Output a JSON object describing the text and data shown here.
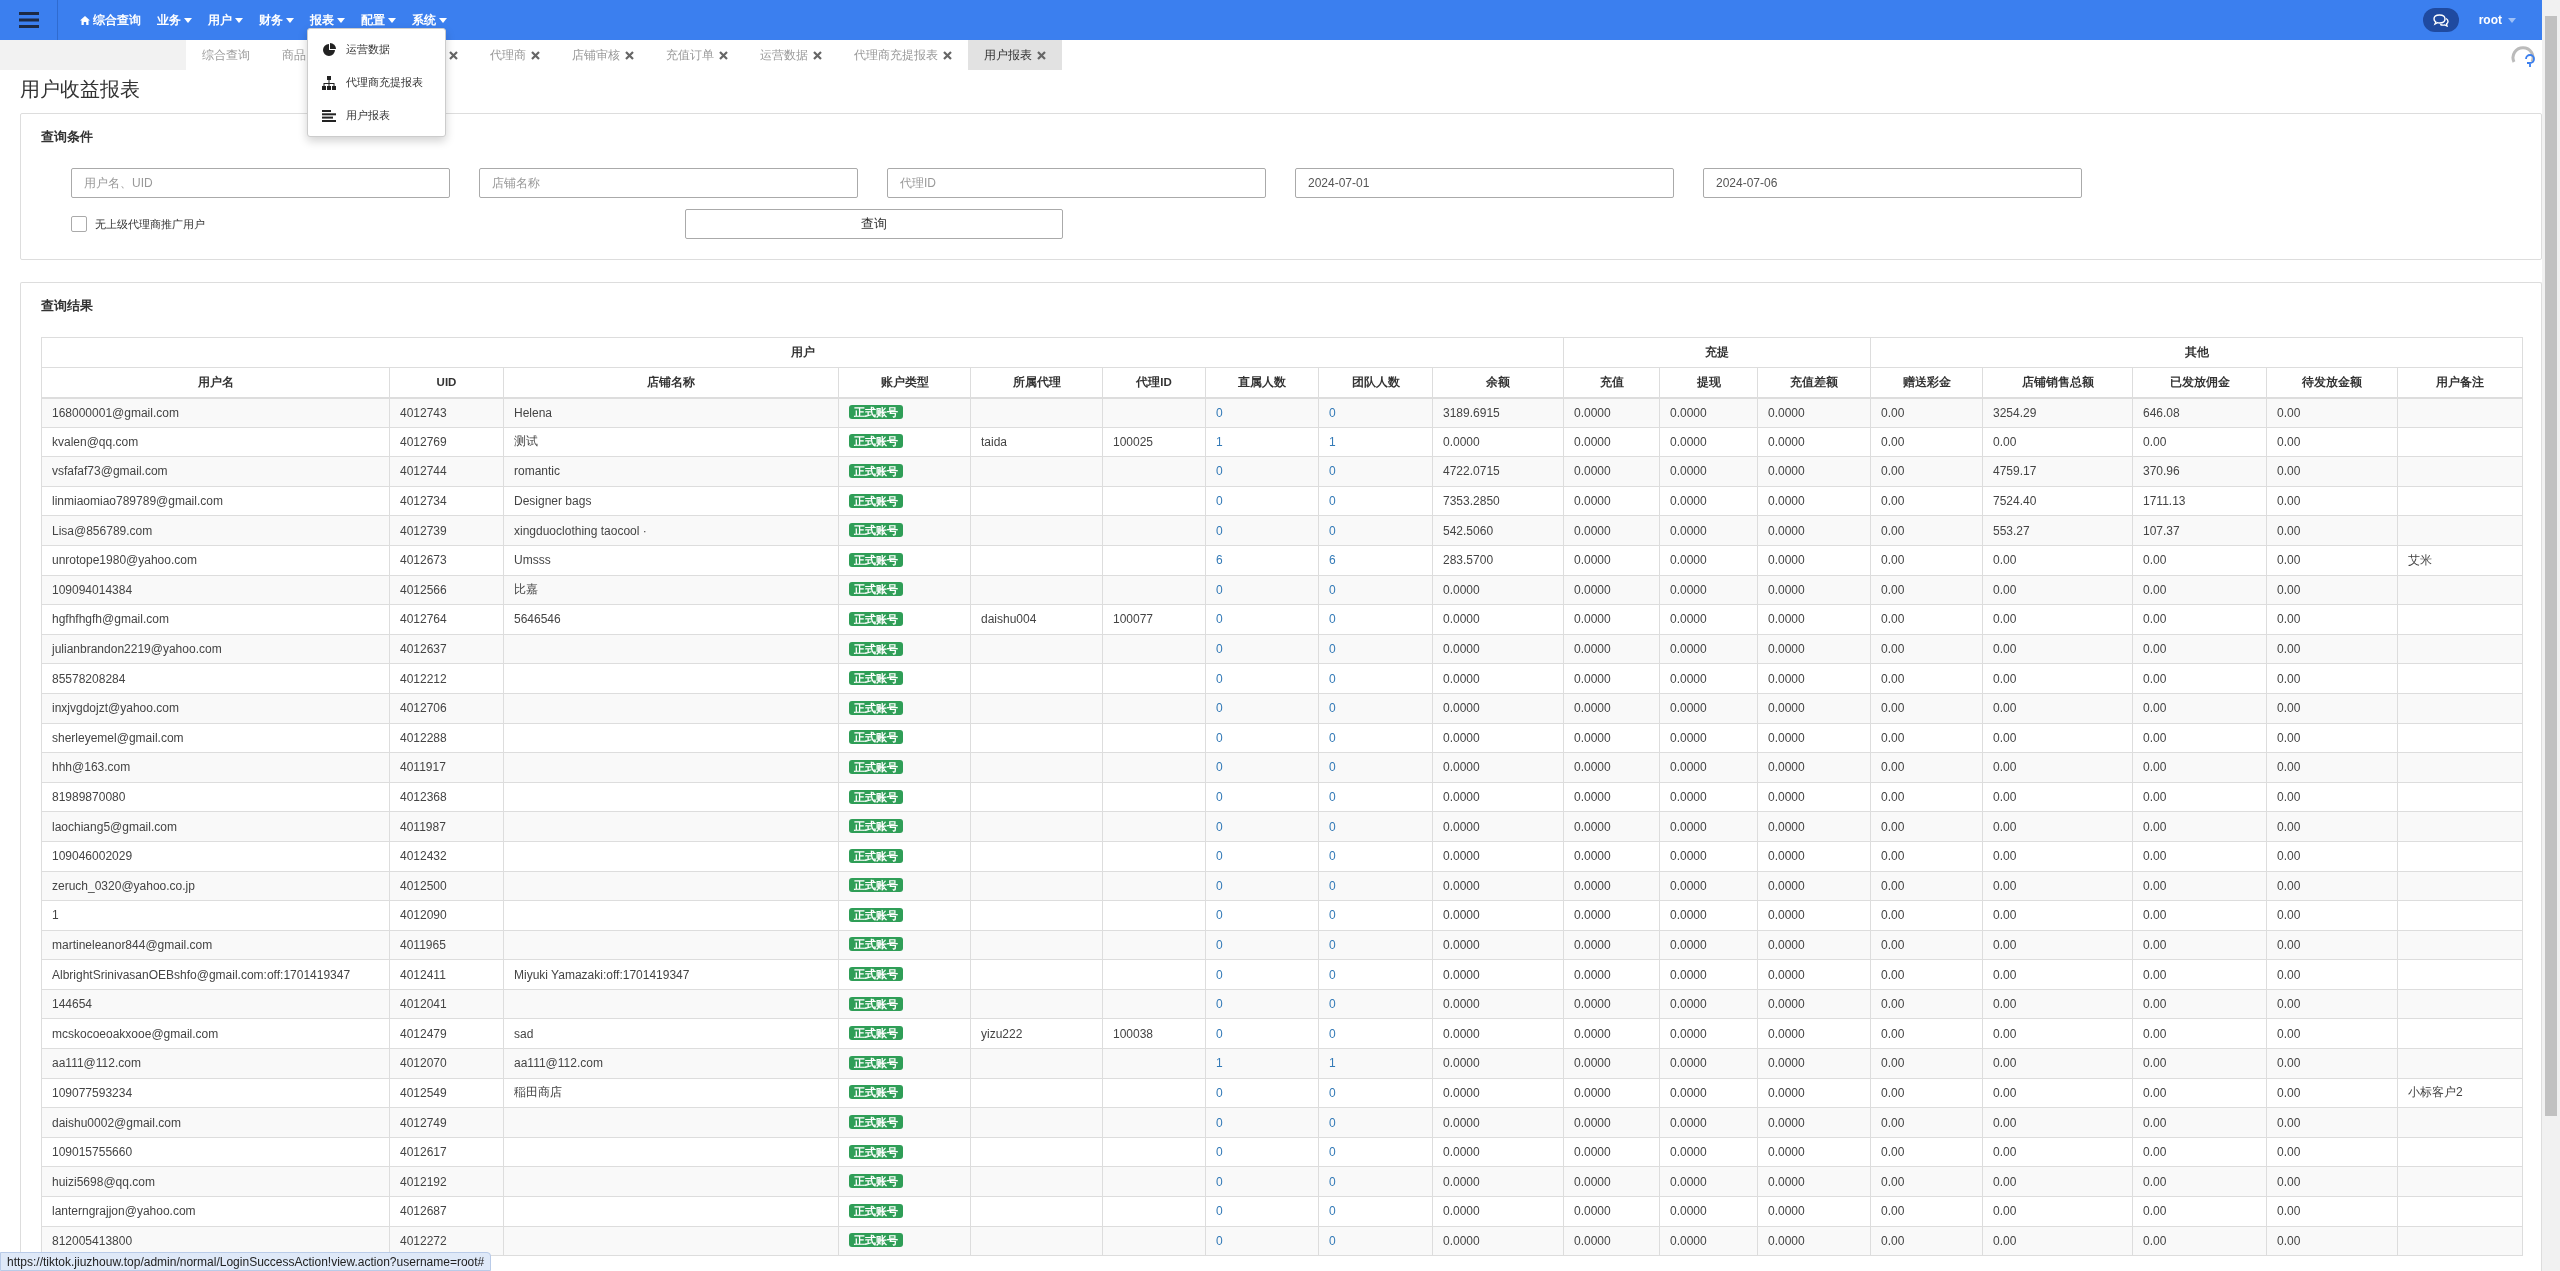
{
  "nav": {
    "items": [
      {
        "kind": "home",
        "label": "综合查询"
      },
      {
        "kind": "menu",
        "label": "业务"
      },
      {
        "kind": "menu",
        "label": "用户"
      },
      {
        "kind": "menu",
        "label": "财务"
      },
      {
        "kind": "menu",
        "label": "报表"
      },
      {
        "kind": "menu",
        "label": "配置"
      },
      {
        "kind": "menu",
        "label": "系统"
      }
    ],
    "user": "root"
  },
  "menu": {
    "items": [
      {
        "label": "运营数据"
      },
      {
        "label": "代理商充提报表"
      },
      {
        "label": "用户报表"
      }
    ]
  },
  "tabs": [
    {
      "label": "综合查询",
      "closable": false,
      "selected": false
    },
    {
      "label": "商品",
      "closable": true,
      "selected": false
    },
    {
      "label": "代理商",
      "closable": true,
      "selected": false
    },
    {
      "label": "店铺审核",
      "closable": true,
      "selected": false
    },
    {
      "label": "充值订单",
      "closable": true,
      "selected": false
    },
    {
      "label": "运营数据",
      "closable": true,
      "selected": false
    },
    {
      "label": "代理商充提报表",
      "closable": true,
      "selected": false
    },
    {
      "label": "用户报表",
      "closable": true,
      "selected": true
    }
  ],
  "page_title": "用户收益报表",
  "query": {
    "title": "查询条件",
    "fields": [
      {
        "placeholder": "用户名、UID"
      },
      {
        "placeholder": "店铺名称"
      },
      {
        "placeholder": "代理ID"
      },
      {
        "value": "2024-07-01"
      },
      {
        "value": "2024-07-06"
      }
    ],
    "checkbox": {
      "label": "无上级代理商推广用户",
      "checked": false
    },
    "button": "查询"
  },
  "results": {
    "title": "查询结果"
  },
  "table": {
    "groups": [
      {
        "label": "用户"
      },
      {
        "label": "充提"
      },
      {
        "label": "其他"
      }
    ],
    "columns": [
      {
        "label": "用户名",
        "kind": "text"
      },
      {
        "label": "UID",
        "kind": "text"
      },
      {
        "label": "店铺名称",
        "kind": "text"
      },
      {
        "label": "账户类型",
        "kind": "badge"
      },
      {
        "label": "所属代理",
        "kind": "text"
      },
      {
        "label": "代理ID",
        "kind": "text"
      },
      {
        "label": "直属人数",
        "kind": "link"
      },
      {
        "label": "团队人数",
        "kind": "link"
      },
      {
        "label": "余额",
        "kind": "text"
      },
      {
        "label": "充值",
        "kind": "text"
      },
      {
        "label": "提现",
        "kind": "text"
      },
      {
        "label": "充值差额",
        "kind": "text"
      },
      {
        "label": "赠送彩金",
        "kind": "text"
      },
      {
        "label": "店铺销售总额",
        "kind": "text"
      },
      {
        "label": "已发放佣金",
        "kind": "text"
      },
      {
        "label": "待发放金额",
        "kind": "text"
      },
      {
        "label": "用户备注",
        "kind": "text"
      }
    ],
    "rows": [
      [
        "168000001@gmail.com",
        "4012743",
        "Helena",
        "正式账号",
        null,
        null,
        "0",
        "0",
        "3189.6915",
        "0.0000",
        "0.0000",
        "0.0000",
        "0.00",
        "3254.29",
        "646.08",
        "0.00",
        null
      ],
      [
        "kvalen@qq.com",
        "4012769",
        "测试",
        "正式账号",
        "taida",
        "100025",
        "1",
        "1",
        "0.0000",
        "0.0000",
        "0.0000",
        "0.0000",
        "0.00",
        "0.00",
        "0.00",
        "0.00",
        null
      ],
      [
        "vsfafaf73@gmail.com",
        "4012744",
        "romantic",
        "正式账号",
        null,
        null,
        "0",
        "0",
        "4722.0715",
        "0.0000",
        "0.0000",
        "0.0000",
        "0.00",
        "4759.17",
        "370.96",
        "0.00",
        null
      ],
      [
        "linmiaomiao789789@gmail.com",
        "4012734",
        "Designer bags",
        "正式账号",
        null,
        null,
        "0",
        "0",
        "7353.2850",
        "0.0000",
        "0.0000",
        "0.0000",
        "0.00",
        "7524.40",
        "1711.13",
        "0.00",
        null
      ],
      [
        "Lisa@856789.com",
        "4012739",
        "xingduoclothing taocool ·",
        "正式账号",
        null,
        null,
        "0",
        "0",
        "542.5060",
        "0.0000",
        "0.0000",
        "0.0000",
        "0.00",
        "553.27",
        "107.37",
        "0.00",
        null
      ],
      [
        "unrotope1980@yahoo.com",
        "4012673",
        "Umsss",
        "正式账号",
        null,
        null,
        "6",
        "6",
        "283.5700",
        "0.0000",
        "0.0000",
        "0.0000",
        "0.00",
        "0.00",
        "0.00",
        "0.00",
        "艾米"
      ],
      [
        "109094014384",
        "4012566",
        "比嘉",
        "正式账号",
        null,
        null,
        "0",
        "0",
        "0.0000",
        "0.0000",
        "0.0000",
        "0.0000",
        "0.00",
        "0.00",
        "0.00",
        "0.00",
        null
      ],
      [
        "hgfhfhgfh@gmail.com",
        "4012764",
        "5646546",
        "正式账号",
        "daishu004",
        "100077",
        "0",
        "0",
        "0.0000",
        "0.0000",
        "0.0000",
        "0.0000",
        "0.00",
        "0.00",
        "0.00",
        "0.00",
        null
      ],
      [
        "julianbrandon2219@yahoo.com",
        "4012637",
        null,
        "正式账号",
        null,
        null,
        "0",
        "0",
        "0.0000",
        "0.0000",
        "0.0000",
        "0.0000",
        "0.00",
        "0.00",
        "0.00",
        "0.00",
        null
      ],
      [
        "85578208284",
        "4012212",
        null,
        "正式账号",
        null,
        null,
        "0",
        "0",
        "0.0000",
        "0.0000",
        "0.0000",
        "0.0000",
        "0.00",
        "0.00",
        "0.00",
        "0.00",
        null
      ],
      [
        "inxjvgdojzt@yahoo.com",
        "4012706",
        null,
        "正式账号",
        null,
        null,
        "0",
        "0",
        "0.0000",
        "0.0000",
        "0.0000",
        "0.0000",
        "0.00",
        "0.00",
        "0.00",
        "0.00",
        null
      ],
      [
        "sherleyemel@gmail.com",
        "4012288",
        null,
        "正式账号",
        null,
        null,
        "0",
        "0",
        "0.0000",
        "0.0000",
        "0.0000",
        "0.0000",
        "0.00",
        "0.00",
        "0.00",
        "0.00",
        null
      ],
      [
        "hhh@163.com",
        "4011917",
        null,
        "正式账号",
        null,
        null,
        "0",
        "0",
        "0.0000",
        "0.0000",
        "0.0000",
        "0.0000",
        "0.00",
        "0.00",
        "0.00",
        "0.00",
        null
      ],
      [
        "81989870080",
        "4012368",
        null,
        "正式账号",
        null,
        null,
        "0",
        "0",
        "0.0000",
        "0.0000",
        "0.0000",
        "0.0000",
        "0.00",
        "0.00",
        "0.00",
        "0.00",
        null
      ],
      [
        "laochiang5@gmail.com",
        "4011987",
        null,
        "正式账号",
        null,
        null,
        "0",
        "0",
        "0.0000",
        "0.0000",
        "0.0000",
        "0.0000",
        "0.00",
        "0.00",
        "0.00",
        "0.00",
        null
      ],
      [
        "109046002029",
        "4012432",
        null,
        "正式账号",
        null,
        null,
        "0",
        "0",
        "0.0000",
        "0.0000",
        "0.0000",
        "0.0000",
        "0.00",
        "0.00",
        "0.00",
        "0.00",
        null
      ],
      [
        "zeruch_0320@yahoo.co.jp",
        "4012500",
        null,
        "正式账号",
        null,
        null,
        "0",
        "0",
        "0.0000",
        "0.0000",
        "0.0000",
        "0.0000",
        "0.00",
        "0.00",
        "0.00",
        "0.00",
        null
      ],
      [
        "1",
        "4012090",
        null,
        "正式账号",
        null,
        null,
        "0",
        "0",
        "0.0000",
        "0.0000",
        "0.0000",
        "0.0000",
        "0.00",
        "0.00",
        "0.00",
        "0.00",
        null
      ],
      [
        "martineleanor844@gmail.com",
        "4011965",
        null,
        "正式账号",
        null,
        null,
        "0",
        "0",
        "0.0000",
        "0.0000",
        "0.0000",
        "0.0000",
        "0.00",
        "0.00",
        "0.00",
        "0.00",
        null
      ],
      [
        "AlbrightSrinivasanOEBshfo@gmail.com:off:1701419347",
        "4012411",
        "Miyuki Yamazaki:off:1701419347",
        "正式账号",
        null,
        null,
        "0",
        "0",
        "0.0000",
        "0.0000",
        "0.0000",
        "0.0000",
        "0.00",
        "0.00",
        "0.00",
        "0.00",
        null
      ],
      [
        "144654",
        "4012041",
        null,
        "正式账号",
        null,
        null,
        "0",
        "0",
        "0.0000",
        "0.0000",
        "0.0000",
        "0.0000",
        "0.00",
        "0.00",
        "0.00",
        "0.00",
        null
      ],
      [
        "mcskocoeoakxooe@gmail.com",
        "4012479",
        "sad",
        "正式账号",
        "yizu222",
        "100038",
        "0",
        "0",
        "0.0000",
        "0.0000",
        "0.0000",
        "0.0000",
        "0.00",
        "0.00",
        "0.00",
        "0.00",
        null
      ],
      [
        "aa111@112.com",
        "4012070",
        "aa111@112.com",
        "正式账号",
        null,
        null,
        "1",
        "1",
        "0.0000",
        "0.0000",
        "0.0000",
        "0.0000",
        "0.00",
        "0.00",
        "0.00",
        "0.00",
        null
      ],
      [
        "109077593234",
        "4012549",
        "稲田商店",
        "正式账号",
        null,
        null,
        "0",
        "0",
        "0.0000",
        "0.0000",
        "0.0000",
        "0.0000",
        "0.00",
        "0.00",
        "0.00",
        "0.00",
        "小标客户2"
      ],
      [
        "daishu0002@gmail.com",
        "4012749",
        null,
        "正式账号",
        null,
        null,
        "0",
        "0",
        "0.0000",
        "0.0000",
        "0.0000",
        "0.0000",
        "0.00",
        "0.00",
        "0.00",
        "0.00",
        null
      ],
      [
        "109015755660",
        "4012617",
        null,
        "正式账号",
        null,
        null,
        "0",
        "0",
        "0.0000",
        "0.0000",
        "0.0000",
        "0.0000",
        "0.00",
        "0.00",
        "0.00",
        "0.00",
        null
      ],
      [
        "huizi5698@qq.com",
        "4012192",
        null,
        "正式账号",
        null,
        null,
        "0",
        "0",
        "0.0000",
        "0.0000",
        "0.0000",
        "0.0000",
        "0.00",
        "0.00",
        "0.00",
        "0.00",
        null
      ],
      [
        "lanterngrajjon@yahoo.com",
        "4012687",
        null,
        "正式账号",
        null,
        null,
        "0",
        "0",
        "0.0000",
        "0.0000",
        "0.0000",
        "0.0000",
        "0.00",
        "0.00",
        "0.00",
        "0.00",
        null
      ],
      [
        "812005413800",
        "4012272",
        null,
        "正式账号",
        null,
        null,
        "0",
        "0",
        "0.0000",
        "0.0000",
        "0.0000",
        "0.0000",
        "0.00",
        "0.00",
        "0.00",
        "0.00",
        null
      ]
    ]
  },
  "status_bar": {
    "url": "https://tiktok.jiuzhouw.top/admin/normal/LoginSuccessAction!view.action?username=root#"
  }
}
